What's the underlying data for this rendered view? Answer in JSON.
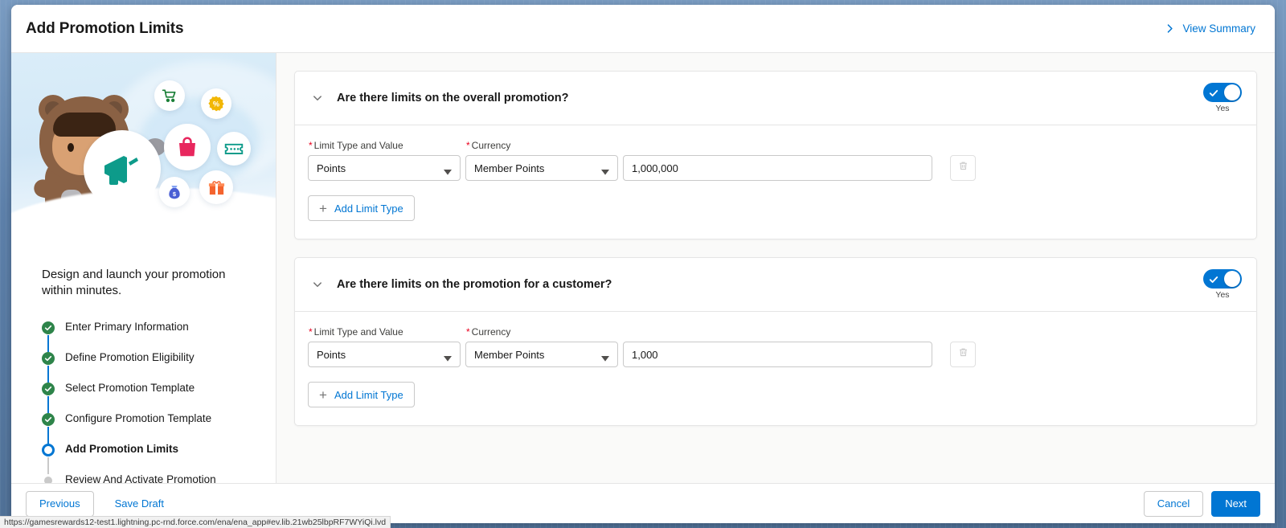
{
  "header": {
    "title": "Add Promotion Limits",
    "view_summary_label": "View Summary",
    "view_summary_icon": "chevron-right-icon"
  },
  "guidance": {
    "tagline": "Design and launch your promotion within minutes.",
    "illustration_icons": [
      "shopping-cart-icon",
      "percent-badge-icon",
      "shopping-bag-icon",
      "ticket-icon",
      "money-bag-icon",
      "gift-icon"
    ],
    "mascot": "astro-bear-mascot",
    "steps": [
      {
        "label": "Enter Primary Information",
        "state": "done"
      },
      {
        "label": "Define Promotion Eligibility",
        "state": "done"
      },
      {
        "label": "Select Promotion Template",
        "state": "done"
      },
      {
        "label": "Configure Promotion Template",
        "state": "done"
      },
      {
        "label": "Add Promotion Limits",
        "state": "current"
      },
      {
        "label": "Review And Activate Promotion",
        "state": "todo"
      }
    ]
  },
  "cards": [
    {
      "question": "Are there limits on the overall promotion?",
      "collapse_icon": "chevron-down-icon",
      "toggle": {
        "value": "Yes",
        "on": true,
        "icon": "check-icon"
      },
      "limit_type": {
        "label": "Limit Type and Value",
        "required": true,
        "value": "Points"
      },
      "currency": {
        "label": "Currency",
        "required": true,
        "value": "Member Points"
      },
      "amount": {
        "value": "1,000,000",
        "placeholder": ""
      },
      "delete_icon": "trash-icon",
      "add_limit_label": "Add Limit Type",
      "add_limit_icon": "plus-icon"
    },
    {
      "question": "Are there limits on the promotion for a customer?",
      "collapse_icon": "chevron-down-icon",
      "toggle": {
        "value": "Yes",
        "on": true,
        "icon": "check-icon"
      },
      "limit_type": {
        "label": "Limit Type and Value",
        "required": true,
        "value": "Points"
      },
      "currency": {
        "label": "Currency",
        "required": true,
        "value": "Member Points"
      },
      "amount": {
        "value": "1,000",
        "placeholder": ""
      },
      "delete_icon": "trash-icon",
      "add_limit_label": "Add Limit Type",
      "add_limit_icon": "plus-icon"
    }
  ],
  "footer": {
    "previous_label": "Previous",
    "save_draft_label": "Save Draft",
    "cancel_label": "Cancel",
    "next_label": "Next"
  },
  "status_bar": {
    "url": "https://gamesrewards12-test1.lightning.pc-rnd.force.com/ena/ena_app#ev.lib.21wb25lbpRF7WYiQi.lvd"
  },
  "colors": {
    "brand_blue": "#0176d3",
    "success_green": "#2e844a",
    "required_red": "#ea001e",
    "canvas": "#fafaf9"
  }
}
